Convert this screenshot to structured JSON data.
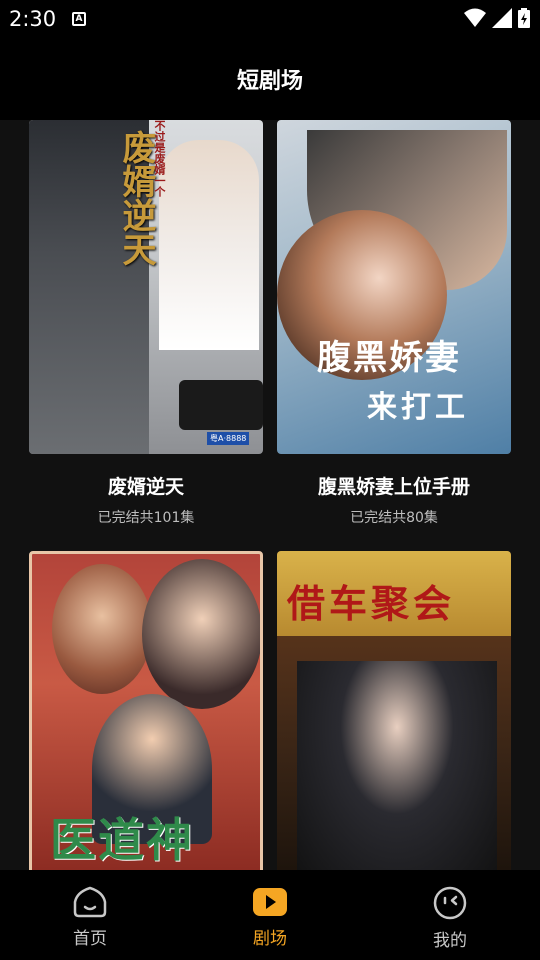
{
  "status_bar": {
    "time": "2:30",
    "notification_letter": "A"
  },
  "header": {
    "title": "短剧场"
  },
  "dramas": [
    {
      "title": "废婿逆天",
      "status": "已完结共101集",
      "poster": {
        "main": "废婿逆天",
        "side": "不过是废婿一个",
        "plate": "粤A·8888"
      }
    },
    {
      "title": "腹黑娇妻上位手册",
      "status": "已完结共80集",
      "poster": {
        "main": "腹黑娇妻",
        "line2": "来打工"
      }
    },
    {
      "title": "",
      "status": "",
      "poster": {
        "main": "医道神"
      }
    },
    {
      "title": "",
      "status": "",
      "poster": {
        "main": "借车聚会"
      }
    }
  ],
  "nav": [
    {
      "label": "首页",
      "icon": "home-face-icon",
      "active": false
    },
    {
      "label": "剧场",
      "icon": "theater-play-icon",
      "active": true
    },
    {
      "label": "我的",
      "icon": "profile-face-icon",
      "active": false
    }
  ],
  "colors": {
    "accent": "#f5a623",
    "background": "#111111",
    "bar": "#000000"
  }
}
